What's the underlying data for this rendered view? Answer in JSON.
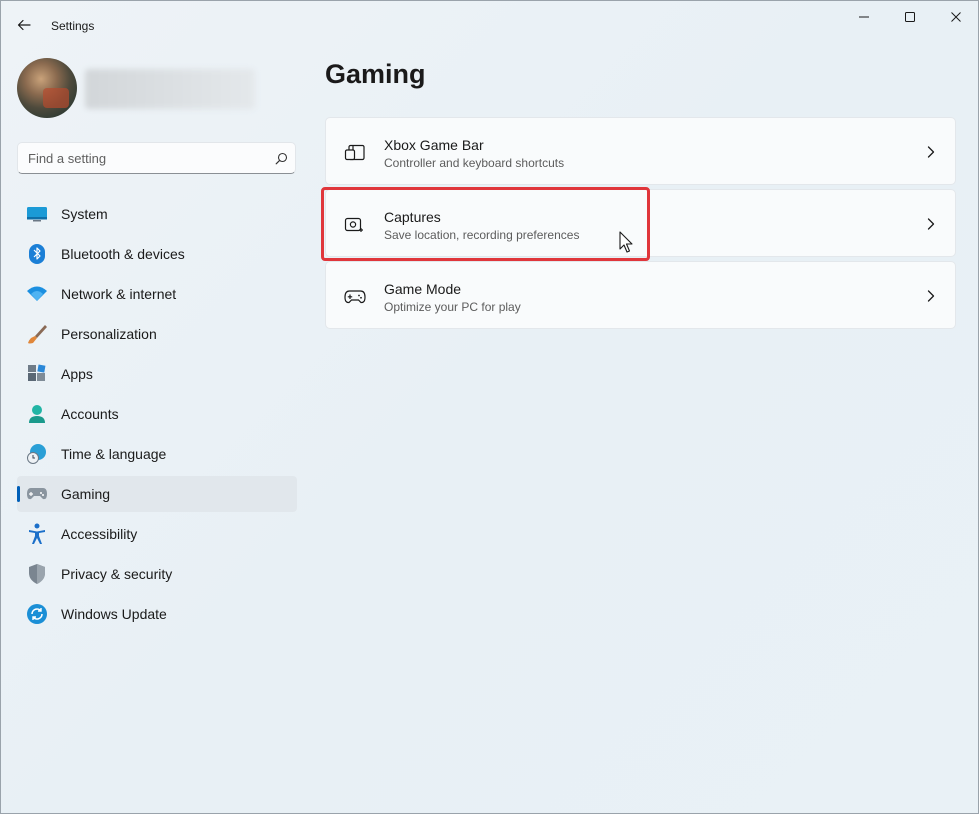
{
  "window": {
    "title": "Settings"
  },
  "search": {
    "placeholder": "Find a setting"
  },
  "sidebar": {
    "items": [
      {
        "label": "System",
        "icon": "system-icon"
      },
      {
        "label": "Bluetooth & devices",
        "icon": "bluetooth-icon"
      },
      {
        "label": "Network & internet",
        "icon": "wifi-icon"
      },
      {
        "label": "Personalization",
        "icon": "brush-icon"
      },
      {
        "label": "Apps",
        "icon": "apps-icon"
      },
      {
        "label": "Accounts",
        "icon": "accounts-icon"
      },
      {
        "label": "Time & language",
        "icon": "globe-clock-icon"
      },
      {
        "label": "Gaming",
        "icon": "gamepad-icon",
        "active": true
      },
      {
        "label": "Accessibility",
        "icon": "accessibility-icon"
      },
      {
        "label": "Privacy & security",
        "icon": "shield-icon"
      },
      {
        "label": "Windows Update",
        "icon": "update-icon"
      }
    ]
  },
  "main": {
    "title": "Gaming",
    "cards": [
      {
        "title": "Xbox Game Bar",
        "subtitle": "Controller and keyboard shortcuts",
        "icon": "game-bar-icon"
      },
      {
        "title": "Captures",
        "subtitle": "Save location, recording preferences",
        "icon": "capture-icon",
        "highlighted": true
      },
      {
        "title": "Game Mode",
        "subtitle": "Optimize your PC for play",
        "icon": "game-mode-icon"
      }
    ]
  },
  "colors": {
    "accent": "#005fb8",
    "highlight_border": "#e0363b",
    "background": "#eaf1f6"
  }
}
